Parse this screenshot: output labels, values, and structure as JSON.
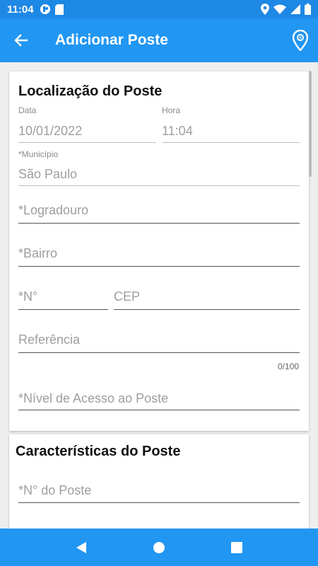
{
  "status_bar": {
    "time": "11:04",
    "left_icons": [
      "app-notification-icon",
      "sd-card-icon"
    ],
    "right_icons": [
      "location-icon",
      "wifi-icon",
      "signal-icon",
      "battery-icon"
    ]
  },
  "app_bar": {
    "title": "Adicionar Poste",
    "back_icon": "back-arrow-icon",
    "action_icon": "location-pin-icon"
  },
  "location_card": {
    "title": "Localização do Poste",
    "date": {
      "label": "Data",
      "value": "10/01/2022"
    },
    "time": {
      "label": "Hora",
      "value": "11:04"
    },
    "municipio": {
      "label": "*Município",
      "value": "São Paulo"
    },
    "logradouro": {
      "placeholder": "*Logradouro"
    },
    "bairro": {
      "placeholder": "*Bairro"
    },
    "numero": {
      "placeholder": "*N°"
    },
    "cep": {
      "placeholder": "CEP"
    },
    "referencia": {
      "placeholder": "Referência",
      "counter": "0/100"
    },
    "nivel_acesso": {
      "placeholder": "*Nível de Acesso ao Poste"
    }
  },
  "characteristics_card": {
    "title": "Características do Poste",
    "numero_poste": {
      "placeholder": "*N° do Poste"
    }
  },
  "colors": {
    "primary": "#2196f3",
    "status_bar": "#1e88e5",
    "background": "#eeeeee"
  }
}
